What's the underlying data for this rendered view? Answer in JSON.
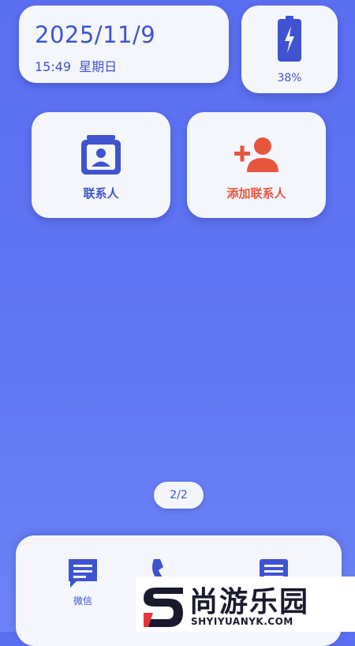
{
  "colors": {
    "accent": "#3f53d1",
    "add_contact": "#e8553d",
    "background": "#5f74f2",
    "card": "#f5f6fb"
  },
  "date_card": {
    "date": "2025/11/9",
    "time": "15:49",
    "weekday": "星期日"
  },
  "battery": {
    "icon": "battery-charging-icon",
    "level_text": "38%",
    "level": 0.38
  },
  "tiles": {
    "contacts": {
      "label": "联系人",
      "icon": "contact-card-icon"
    },
    "add_contact": {
      "label": "添加联系人",
      "icon": "add-person-icon"
    }
  },
  "pager": {
    "text": "2/2"
  },
  "dock": {
    "apps": [
      {
        "label": "微信",
        "icon": "chat-bubble-icon"
      },
      {
        "label": "",
        "icon": "phone-icon"
      },
      {
        "label": "",
        "icon": "message-icon"
      }
    ]
  },
  "watermark": {
    "name": "尚游乐园",
    "url": "SHYIYUANYK.COM"
  }
}
